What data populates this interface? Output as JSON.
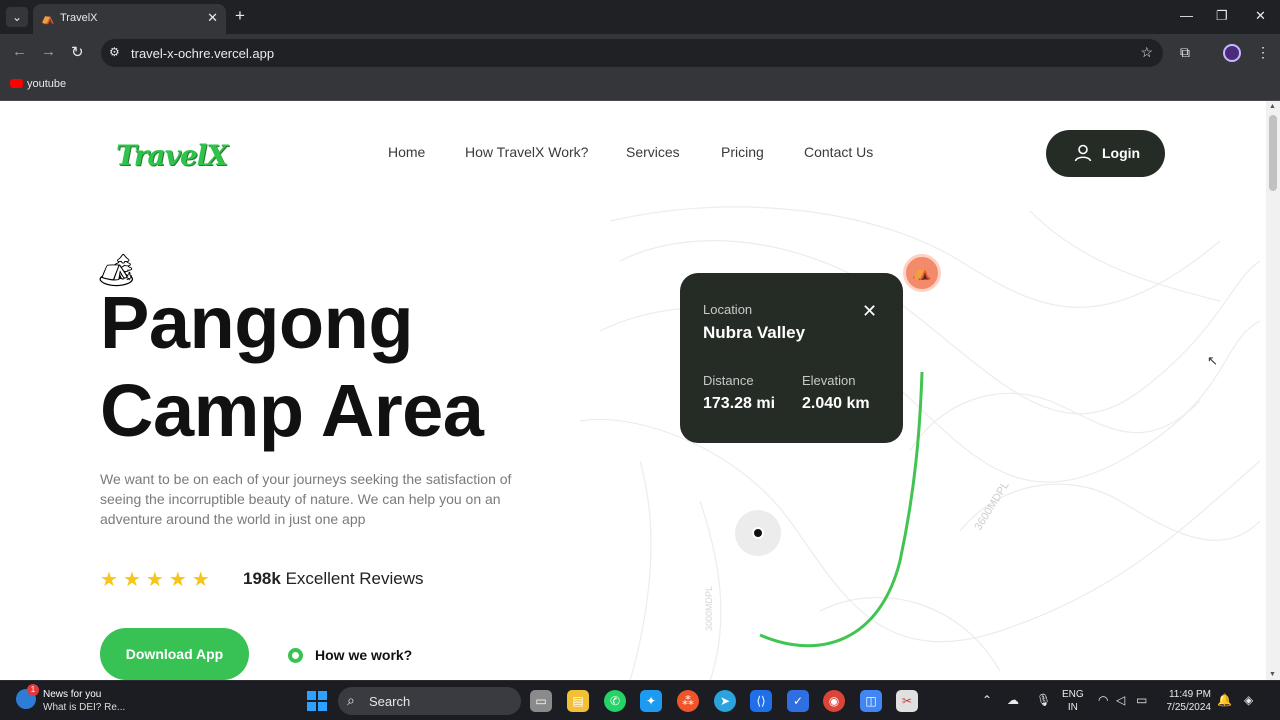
{
  "browser": {
    "tab_title": "TravelX",
    "url": "travel-x-ochre.vercel.app",
    "bookmark": "youtube"
  },
  "page": {
    "logo": "TravelX",
    "nav": [
      "Home",
      "How TravelX Work?",
      "Services",
      "Pricing",
      "Contact Us"
    ],
    "login_label": "Login",
    "hero_line1": "Pangong",
    "hero_line2": "Camp Area",
    "description": "We want to be on each of your journeys seeking the satisfaction of seeing the incorruptible beauty of nature. We can help you on an adventure around the world in just one app",
    "rating_stars": 5,
    "reviews_count": "198k",
    "reviews_label": "Excellent Reviews",
    "download_label": "Download App",
    "how_label": "How we work?",
    "map_card": {
      "location_label": "Location",
      "location_value": "Nubra Valley",
      "distance_label": "Distance",
      "distance_value": "173.28 mi",
      "elevation_label": "Elevation",
      "elevation_value": "2.040 km"
    },
    "contour_label": "3600MDPL",
    "contour_label2": "3000MDPL"
  },
  "taskbar": {
    "news_title": "News for you",
    "news_sub": "What is DEI? Re...",
    "news_badge": "1",
    "search": "Search",
    "lang_1": "ENG",
    "lang_2": "IN",
    "time": "11:49 PM",
    "date": "7/25/2024"
  },
  "colors": {
    "accent_green": "#38c254",
    "dark_card": "#242c25",
    "pin": "#f38a6a",
    "star": "#f5c518"
  }
}
